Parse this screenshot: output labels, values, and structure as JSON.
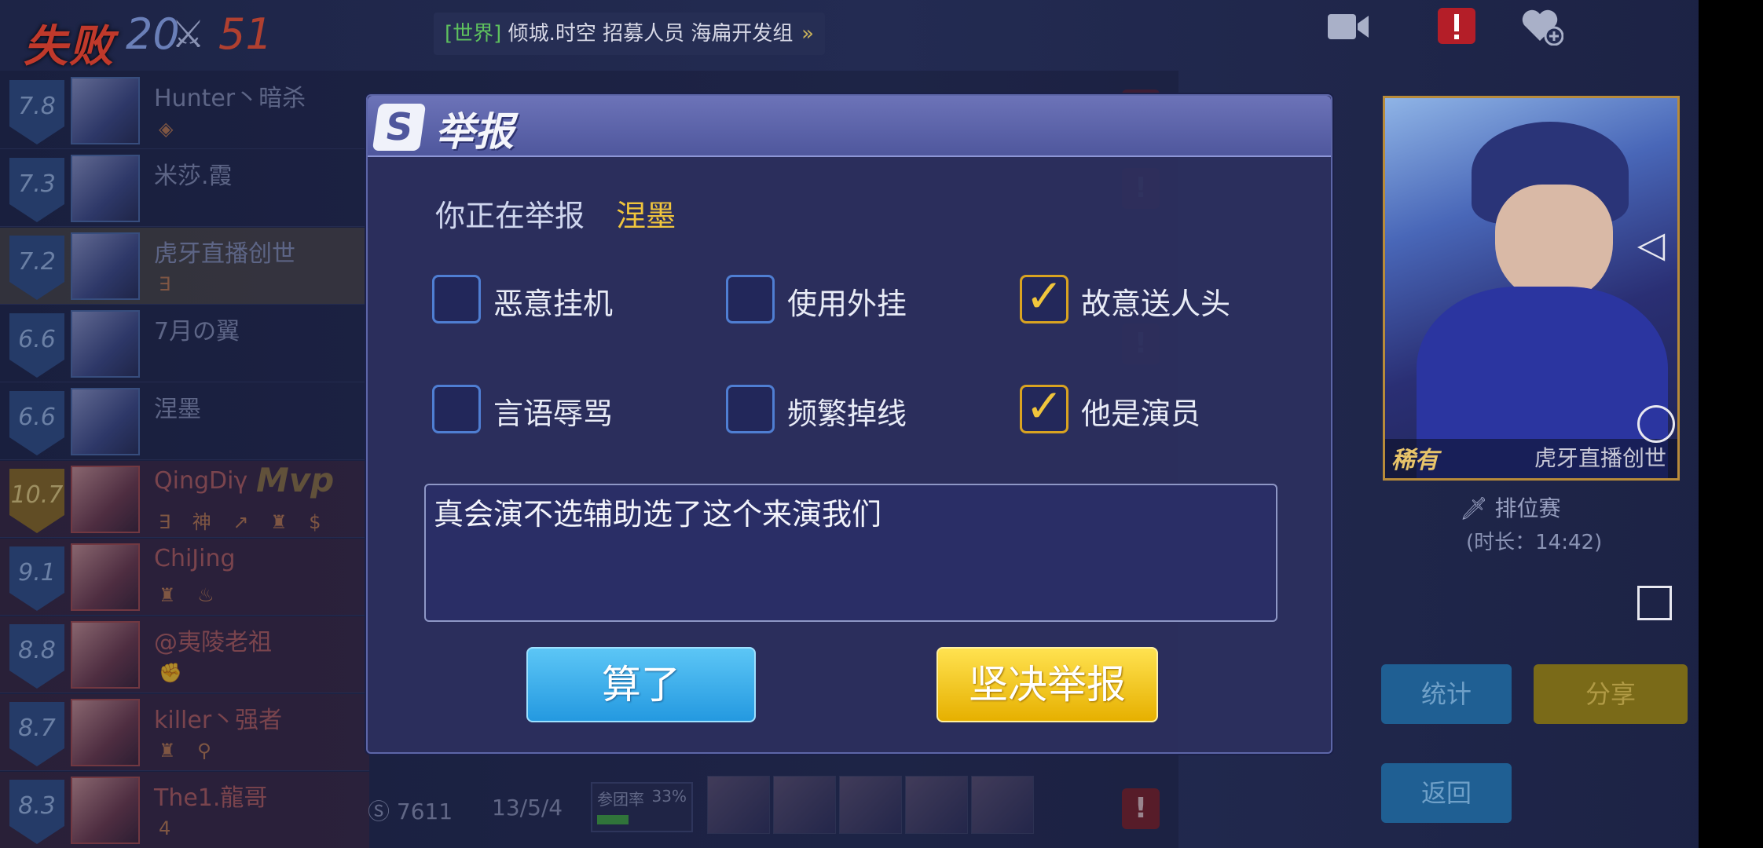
{
  "header": {
    "result": "失败",
    "score_left": "20",
    "score_right": "51",
    "ticker_channel": "[世界]",
    "ticker_text": "倾城.时空 招募人员 海扁开发组",
    "ticker_arrow": "»"
  },
  "players": [
    {
      "rating": "7.8",
      "name": "Hunter丶暗杀",
      "tags": "◈",
      "team": "blue"
    },
    {
      "rating": "7.3",
      "name": "米莎.霞",
      "tags": "",
      "team": "blue"
    },
    {
      "rating": "7.2",
      "name": "虎牙直播创世",
      "tags": "∃",
      "team": "blue",
      "highlight": true
    },
    {
      "rating": "6.6",
      "name": "7月の翼",
      "tags": "",
      "team": "blue"
    },
    {
      "rating": "6.6",
      "name": "涅墨",
      "tags": "",
      "team": "blue"
    },
    {
      "rating": "10.7",
      "name": "QingDiγ",
      "tags": "∃ 神 ↗ ♜ $",
      "team": "red",
      "mvp": "Mvp"
    },
    {
      "rating": "9.1",
      "name": "ChiJing",
      "tags": "♜ ♨",
      "team": "red"
    },
    {
      "rating": "8.8",
      "name": "@夷陵老祖",
      "tags": "✊",
      "team": "red"
    },
    {
      "rating": "8.7",
      "name": "killer丶强者",
      "tags": "♜ ⚲",
      "team": "red"
    },
    {
      "rating": "8.3",
      "name": "The1.龍哥",
      "tags": "4",
      "team": "red"
    }
  ],
  "bottom_row_stats": {
    "gold": "7611",
    "kda": "13/5/4",
    "participation_label": "参团率",
    "participation_value": "33%"
  },
  "right_panel": {
    "hero_name": "虎牙直播创世",
    "skin_rarity": "稀有",
    "mode": "排位赛",
    "duration": "(时长：14:42)",
    "stats_button": "统计",
    "share_button": "分享",
    "back_button": "返回"
  },
  "dialog": {
    "title": "举报",
    "reporting_prefix": "你正在举报",
    "reporting_target": "涅墨",
    "options": [
      {
        "label": "恶意挂机",
        "checked": false
      },
      {
        "label": "使用外挂",
        "checked": false
      },
      {
        "label": "故意送人头",
        "checked": true
      },
      {
        "label": "言语辱骂",
        "checked": false
      },
      {
        "label": "频繁掉线",
        "checked": false
      },
      {
        "label": "他是演员",
        "checked": true
      }
    ],
    "note_text": "真会演不选辅助选了这个来演我们",
    "cancel_button": "算了",
    "confirm_button": "坚决举报"
  },
  "colors": {
    "accent_gold": "#f0c53c",
    "defeat_red": "#c0392b",
    "cancel_blue": "#2499e0",
    "confirm_yellow": "#e6b000"
  }
}
